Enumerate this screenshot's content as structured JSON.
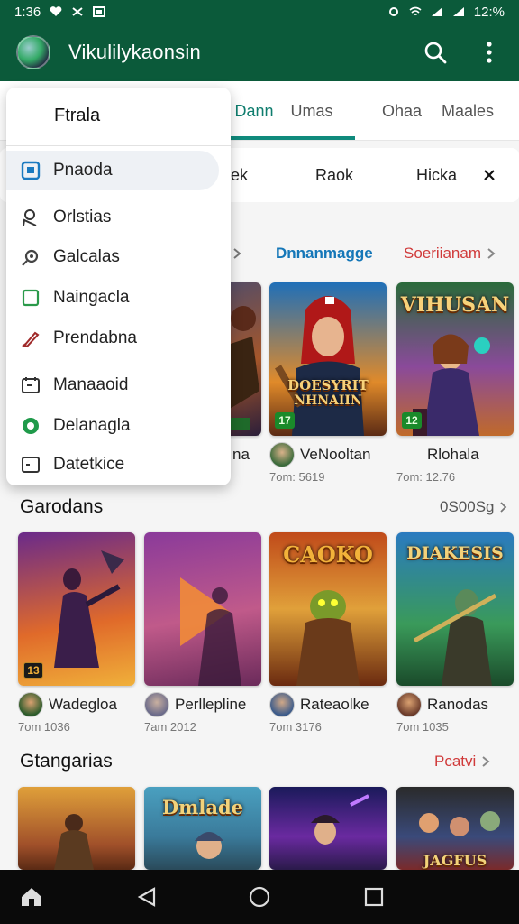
{
  "status_bar": {
    "time": "1:36",
    "battery": "12:%"
  },
  "app_bar": {
    "title": "Vikulilykaonsin"
  },
  "tabs": [
    "Dann",
    "Umas",
    "Ohaa",
    "Maales"
  ],
  "chips": [
    "ek",
    "Raok",
    "Hicka"
  ],
  "menu": {
    "title": "Ftrala",
    "items": [
      {
        "label": "Pnaoda",
        "icon": "square-info-icon"
      },
      {
        "label": "Orlstias",
        "icon": "person-outline-icon"
      },
      {
        "label": "Galcalas",
        "icon": "tag-icon"
      },
      {
        "label": "Naingacla",
        "icon": "checkbox-icon"
      },
      {
        "label": "Prendabna",
        "icon": "brush-icon"
      },
      {
        "label": "Manaaoid",
        "icon": "calendar-icon"
      },
      {
        "label": "Delanagla",
        "icon": "green-circle-icon"
      },
      {
        "label": "Datetkice",
        "icon": "document-icon"
      }
    ]
  },
  "section1": {
    "link_blue": "Dnnanmagge",
    "link_red": "Soeriianam",
    "cards": [
      {
        "name": "",
        "sub": "",
        "partial_name": "na"
      },
      {
        "name": "VeNooltan",
        "sub": "7om: 5619",
        "badge": "17",
        "art_text_line1": "DOESYRIT",
        "art_text_line2": "NHNAIIN"
      },
      {
        "name": "Rlohala",
        "sub": "7om: 12.76",
        "badge": "12",
        "art_text_line1": "VIHUSAN"
      }
    ]
  },
  "section2": {
    "title": "Garodans",
    "link": "0S00Sg",
    "cards": [
      {
        "name": "Wadegloa",
        "sub": "7om 1036",
        "badge": "13"
      },
      {
        "name": "Perllepline",
        "sub": "7am 2012"
      },
      {
        "name": "Rateaolke",
        "sub": "7om 3176",
        "art_text": "CAOKO"
      },
      {
        "name": "Ranodas",
        "sub": "7om 1035",
        "art_text": "DIAKESIS"
      }
    ]
  },
  "section3": {
    "title": "Gtangarias",
    "link": "Pcatvi",
    "cards": [
      {
        "art_text": ""
      },
      {
        "art_text": "Dmlade"
      },
      {
        "art_text": ""
      },
      {
        "art_text": "JAGFUS"
      }
    ]
  },
  "colors": {
    "primary": "#0b5a3a",
    "accent_teal": "#0f8a7c",
    "link_blue": "#1577b8",
    "link_red": "#d03a3a"
  }
}
